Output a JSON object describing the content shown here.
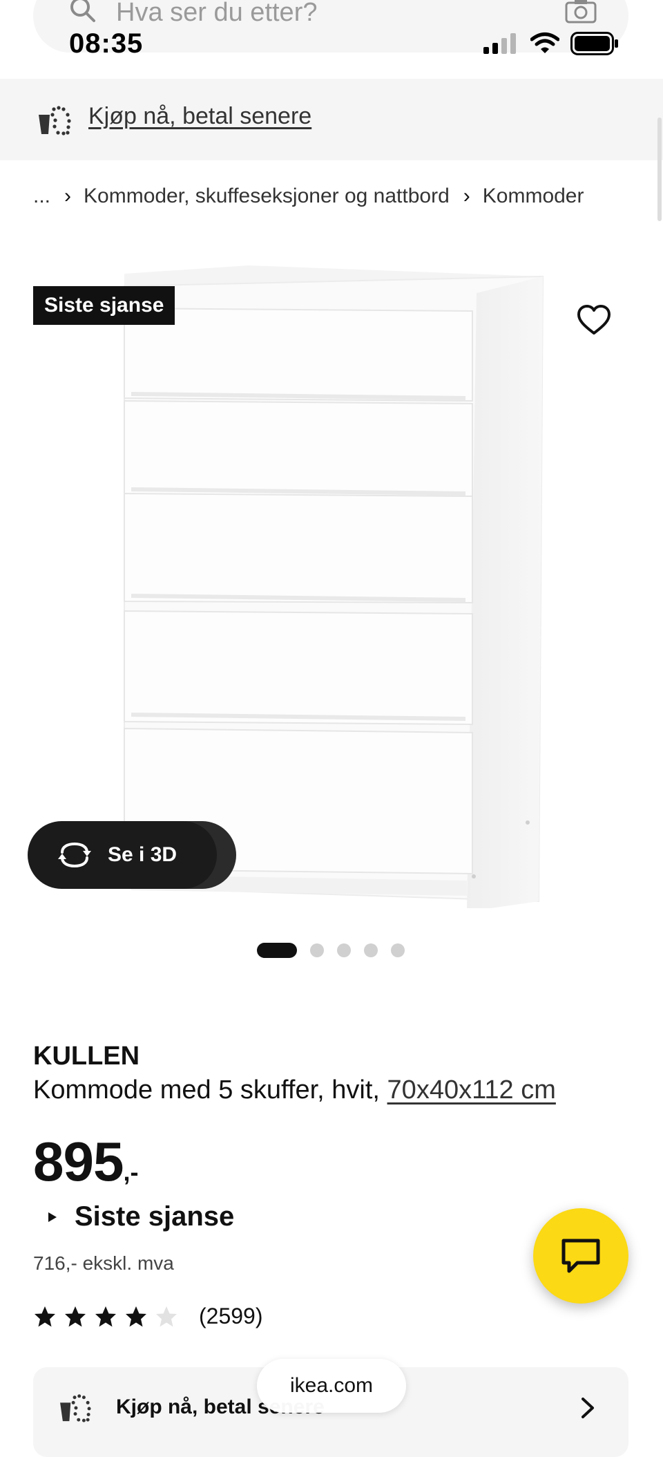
{
  "search": {
    "placeholder": "Hva ser du etter?"
  },
  "status_bar": {
    "time": "08:35"
  },
  "banner": {
    "label": "Kjøp nå, betal senere"
  },
  "breadcrumb": {
    "ellipsis": "...",
    "items": [
      "Kommoder, skuffeseksjoner og nattbord",
      "Kommoder"
    ]
  },
  "product_image": {
    "badge": "Siste sjanse",
    "view_3d_label": "Se i 3D"
  },
  "carousel": {
    "total": 5,
    "active_index": 0
  },
  "product": {
    "name": "KULLEN",
    "description": "Kommode med 5 skuffer, hvit,",
    "dimensions": "70x40x112 cm",
    "price_main": "895",
    "price_suffix": ",-",
    "availability_label": "Siste sjanse",
    "price_ex_vat": "716,- ekskl. mva",
    "rating": {
      "stars": 4,
      "max": 5,
      "review_count": "(2599)"
    }
  },
  "bottom_card": {
    "label": "Kjøp nå, betal senere"
  },
  "browser": {
    "url": "ikea.com"
  },
  "colors": {
    "chat_fab": "#fbd914",
    "badge_bg": "#111111",
    "banner_bg": "#f5f5f5"
  }
}
